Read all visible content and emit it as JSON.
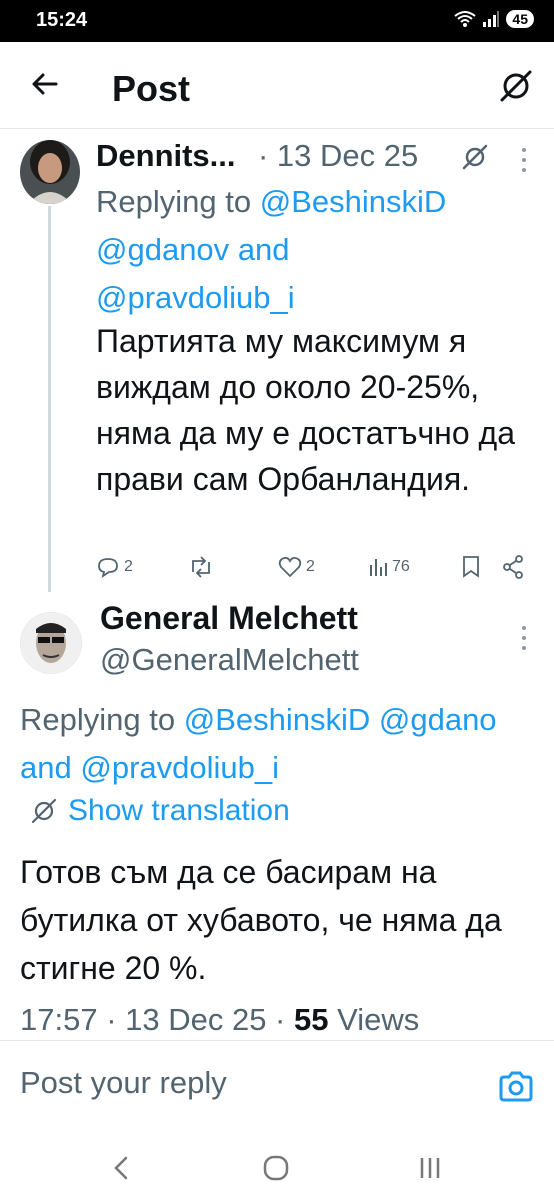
{
  "status_bar": {
    "time": "15:24",
    "battery": "45"
  },
  "header": {
    "title": "Post",
    "back_icon": "arrow-left-icon",
    "grok_icon": "grok-icon"
  },
  "post1": {
    "author": "Dennits...",
    "date": "· 13 Dec 25",
    "reply_prefix": "Replying to",
    "mention1": "@BeshinskiD",
    "mention2": "@gdanov",
    "and": "and",
    "mention3": "@pravdoliub_i",
    "body": "Партията му максимум я виждам до около 20-25%, няма да му е достатъчно да прави сам Орбанландия.",
    "replies": "2",
    "likes": "2",
    "views": "76"
  },
  "post2": {
    "author": "General Melchett",
    "handle": "@GeneralMelchett",
    "reply_prefix": "Replying to",
    "mention1": "@BeshinskiD",
    "mention2": "@gdano",
    "and": "and",
    "mention3": "@pravdoliub_i",
    "translate": "Show translation",
    "body": "Готов съм да се басирам на бутилка от хубавото, че няма да стигне 20 %.",
    "time_date": "17:57 · 13 Dec 25 ·",
    "views_count": "55",
    "views_label": "Views"
  },
  "reply_bar": {
    "placeholder": "Post your reply"
  },
  "colors": {
    "accent": "#1d9bf0",
    "muted": "#536471",
    "text": "#0f1419"
  }
}
